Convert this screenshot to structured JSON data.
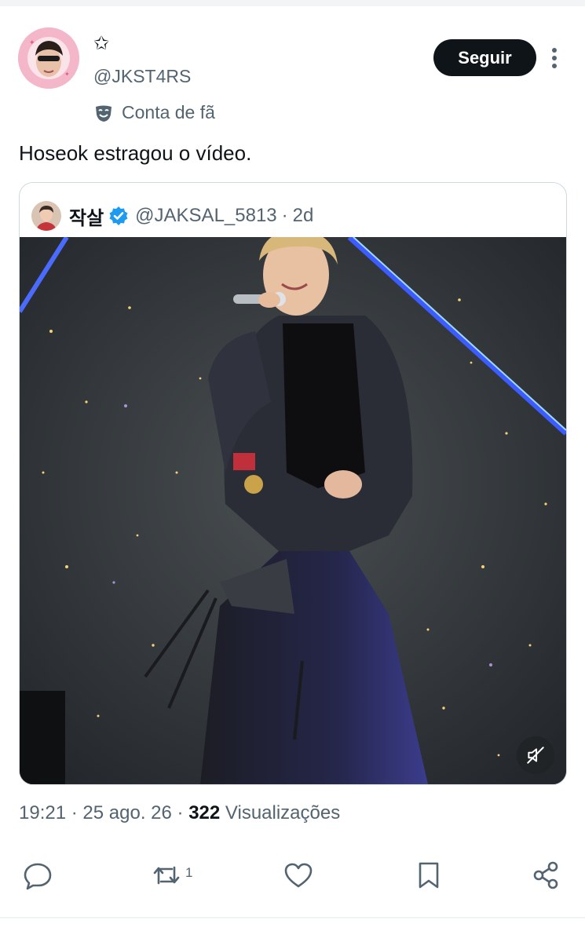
{
  "author": {
    "display_name": "✩",
    "handle": "@JKST4RS",
    "label": "Conta de fã"
  },
  "follow_button": "Seguir",
  "tweet": {
    "text": "Hoseok estragou o vídeo."
  },
  "quote": {
    "name": "작살",
    "handle": "@JAKSAL_5813",
    "separator": "·",
    "time": "2d"
  },
  "meta": {
    "time": "19:21",
    "date": "25 ago. 26",
    "views_count": "322",
    "views_label": "Visualizações",
    "separator": "·"
  },
  "actions": {
    "retweet_count": "1"
  },
  "icons": {
    "more": "more-vertical-icon",
    "fan": "mask-icon",
    "verified": "verified-badge-icon",
    "mute": "muted-speaker-icon",
    "reply": "comment-icon",
    "retweet": "retweet-icon",
    "like": "heart-icon",
    "bookmark": "bookmark-icon",
    "share": "share-icon"
  },
  "colors": {
    "accent": "#1d9bf0",
    "text": "#0f1419",
    "muted": "#536471",
    "button": "#0f1419"
  }
}
